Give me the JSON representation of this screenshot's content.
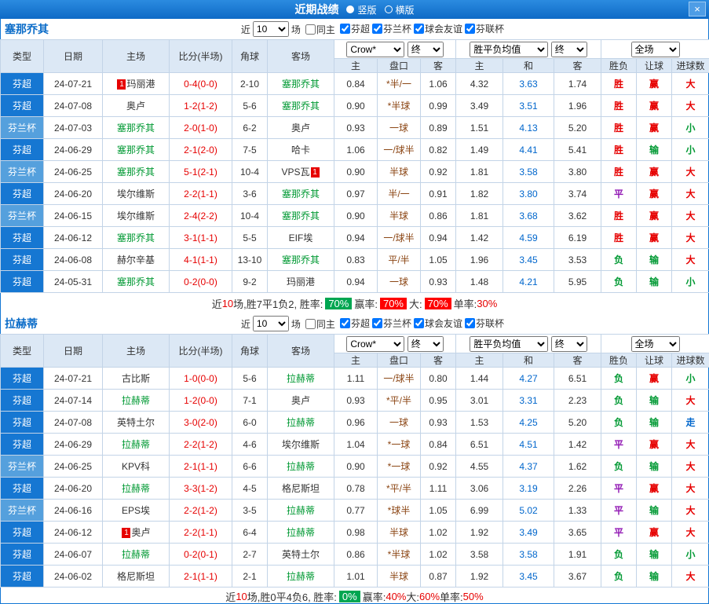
{
  "titlebar": {
    "title": "近期战绩",
    "close_label": "×",
    "layout_options": [
      {
        "label": "竖版",
        "selected": true
      },
      {
        "label": "横版",
        "selected": false
      }
    ]
  },
  "filter": {
    "recent_label": "近",
    "recent_value": "10",
    "games_label": "场",
    "same_home_label": "同主",
    "same_home_checked": false,
    "leagues": [
      "芬超",
      "芬兰杯",
      "球会友谊",
      "芬联杯"
    ],
    "leagues_checked": true
  },
  "table_header": {
    "type": "类型",
    "date": "日期",
    "home": "主场",
    "score": "比分(半场)",
    "corner": "角球",
    "away": "客场",
    "odds_source": "Crow*",
    "odds_time": "终",
    "avg_label": "胜平负均值",
    "avg_time": "终",
    "scope": "全场",
    "home_odds": "主",
    "handicap": "盘口",
    "away_odds": "客",
    "avg_home": "主",
    "avg_draw": "和",
    "avg_away": "客",
    "result": "胜负",
    "handicap_result": "让球",
    "goals": "进球数"
  },
  "league_classes": {
    "芬超": "lg-a",
    "芬兰杯": "lg-b"
  },
  "result_classes": {
    "胜": "r-red",
    "赢": "r-red",
    "大": "r-red",
    "负": "r-green",
    "输": "r-green",
    "小": "r-green",
    "平": "r-purple",
    "走": "r-blue"
  },
  "colors": {
    "title_bar": "#1377d4",
    "league_super": "#1677d2",
    "league_cup": "#55a0dd",
    "team_highlight": "#009933",
    "score": "#e60000",
    "win": "#e60000",
    "lose": "#009933",
    "draw": "#9016b3",
    "push": "#0066cc",
    "badge_green": "#00a651",
    "badge_red": "#fe0000"
  },
  "sections": [
    {
      "team": "塞那乔其",
      "rows": [
        {
          "l": "芬超",
          "d": "24-07-21",
          "h": "玛丽港",
          "hb": "1",
          "ht": false,
          "s": "0-4(0-0)",
          "c": "2-10",
          "a": "塞那乔其",
          "at": true,
          "o1": "0.84",
          "hc": "*半/一",
          "o2": "1.06",
          "v1": "4.32",
          "v2": "3.63",
          "v3": "1.74",
          "r1": "胜",
          "r2": "赢",
          "r3": "大"
        },
        {
          "l": "芬超",
          "d": "24-07-08",
          "h": "奥卢",
          "ht": false,
          "s": "1-2(1-2)",
          "c": "5-6",
          "a": "塞那乔其",
          "at": true,
          "o1": "0.90",
          "hc": "*半球",
          "o2": "0.99",
          "v1": "3.49",
          "v2": "3.51",
          "v3": "1.96",
          "r1": "胜",
          "r2": "赢",
          "r3": "大"
        },
        {
          "l": "芬兰杯",
          "d": "24-07-03",
          "h": "塞那乔其",
          "ht": true,
          "s": "2-0(1-0)",
          "c": "6-2",
          "a": "奥卢",
          "at": false,
          "o1": "0.93",
          "hc": "一球",
          "o2": "0.89",
          "v1": "1.51",
          "v2": "4.13",
          "v3": "5.20",
          "r1": "胜",
          "r2": "赢",
          "r3": "小"
        },
        {
          "l": "芬超",
          "d": "24-06-29",
          "h": "塞那乔其",
          "ht": true,
          "s": "2-1(2-0)",
          "c": "7-5",
          "a": "哈卡",
          "at": false,
          "o1": "1.06",
          "hc": "一/球半",
          "o2": "0.82",
          "v1": "1.49",
          "v2": "4.41",
          "v3": "5.41",
          "r1": "胜",
          "r2": "输",
          "r3": "小"
        },
        {
          "l": "芬兰杯",
          "d": "24-06-25",
          "h": "塞那乔其",
          "ht": true,
          "s": "5-1(2-1)",
          "c": "10-4",
          "a": "VPS瓦",
          "ab": "1",
          "abp": "after",
          "at": false,
          "o1": "0.90",
          "hc": "半球",
          "o2": "0.92",
          "v1": "1.81",
          "v2": "3.58",
          "v3": "3.80",
          "r1": "胜",
          "r2": "赢",
          "r3": "大"
        },
        {
          "l": "芬超",
          "d": "24-06-20",
          "h": "埃尔维斯",
          "ht": false,
          "s": "2-2(1-1)",
          "c": "3-6",
          "a": "塞那乔其",
          "at": true,
          "o1": "0.97",
          "hc": "半/一",
          "o2": "0.91",
          "v1": "1.82",
          "v2": "3.80",
          "v3": "3.74",
          "r1": "平",
          "r2": "赢",
          "r3": "大"
        },
        {
          "l": "芬兰杯",
          "d": "24-06-15",
          "h": "埃尔维斯",
          "ht": false,
          "s": "2-4(2-2)",
          "c": "10-4",
          "a": "塞那乔其",
          "at": true,
          "o1": "0.90",
          "hc": "半球",
          "o2": "0.86",
          "v1": "1.81",
          "v2": "3.68",
          "v3": "3.62",
          "r1": "胜",
          "r2": "赢",
          "r3": "大"
        },
        {
          "l": "芬超",
          "d": "24-06-12",
          "h": "塞那乔其",
          "ht": true,
          "s": "3-1(1-1)",
          "c": "5-5",
          "a": "EIF埃",
          "at": false,
          "o1": "0.94",
          "hc": "一/球半",
          "o2": "0.94",
          "v1": "1.42",
          "v2": "4.59",
          "v3": "6.19",
          "r1": "胜",
          "r2": "赢",
          "r3": "大"
        },
        {
          "l": "芬超",
          "d": "24-06-08",
          "h": "赫尔辛基",
          "ht": false,
          "s": "4-1(1-1)",
          "c": "13-10",
          "a": "塞那乔其",
          "at": true,
          "o1": "0.83",
          "hc": "平/半",
          "o2": "1.05",
          "v1": "1.96",
          "v2": "3.45",
          "v3": "3.53",
          "r1": "负",
          "r2": "输",
          "r3": "大"
        },
        {
          "l": "芬超",
          "d": "24-05-31",
          "h": "塞那乔其",
          "ht": true,
          "s": "0-2(0-0)",
          "c": "9-2",
          "a": "玛丽港",
          "at": false,
          "o1": "0.94",
          "hc": "一球",
          "o2": "0.93",
          "v1": "1.48",
          "v2": "4.21",
          "v3": "5.95",
          "r1": "负",
          "r2": "输",
          "r3": "小"
        }
      ],
      "summary": [
        {
          "t": "近",
          "c": "plain"
        },
        {
          "t": "10",
          "c": "red"
        },
        {
          "t": "场,胜7平1负2, 胜率: ",
          "c": "plain"
        },
        {
          "t": "70%",
          "c": "badge-green"
        },
        {
          "t": " 赢率: ",
          "c": "plain"
        },
        {
          "t": "70%",
          "c": "badge-red"
        },
        {
          "t": " 大: ",
          "c": "plain"
        },
        {
          "t": "70%",
          "c": "badge-red"
        },
        {
          "t": " 单率:",
          "c": "plain"
        },
        {
          "t": "30%",
          "c": "red"
        }
      ]
    },
    {
      "team": "拉赫蒂",
      "rows": [
        {
          "l": "芬超",
          "d": "24-07-21",
          "h": "古比斯",
          "ht": false,
          "s": "1-0(0-0)",
          "c": "5-6",
          "a": "拉赫蒂",
          "at": true,
          "o1": "1.11",
          "hc": "一/球半",
          "o2": "0.80",
          "v1": "1.44",
          "v2": "4.27",
          "v3": "6.51",
          "r1": "负",
          "r2": "赢",
          "r3": "小"
        },
        {
          "l": "芬超",
          "d": "24-07-14",
          "h": "拉赫蒂",
          "ht": true,
          "s": "1-2(0-0)",
          "c": "7-1",
          "a": "奥卢",
          "at": false,
          "o1": "0.93",
          "hc": "*平/半",
          "o2": "0.95",
          "v1": "3.01",
          "v2": "3.31",
          "v3": "2.23",
          "r1": "负",
          "r2": "输",
          "r3": "大"
        },
        {
          "l": "芬超",
          "d": "24-07-08",
          "h": "英特土尔",
          "ht": false,
          "s": "3-0(2-0)",
          "c": "6-0",
          "a": "拉赫蒂",
          "at": true,
          "o1": "0.96",
          "hc": "一球",
          "o2": "0.93",
          "v1": "1.53",
          "v2": "4.25",
          "v3": "5.20",
          "r1": "负",
          "r2": "输",
          "r3": "走"
        },
        {
          "l": "芬超",
          "d": "24-06-29",
          "h": "拉赫蒂",
          "ht": true,
          "s": "2-2(1-2)",
          "c": "4-6",
          "a": "埃尔维斯",
          "at": false,
          "o1": "1.04",
          "hc": "*一球",
          "o2": "0.84",
          "v1": "6.51",
          "v2": "4.51",
          "v3": "1.42",
          "r1": "平",
          "r2": "赢",
          "r3": "大"
        },
        {
          "l": "芬兰杯",
          "d": "24-06-25",
          "h": "KPV科",
          "ht": false,
          "s": "2-1(1-1)",
          "c": "6-6",
          "a": "拉赫蒂",
          "at": true,
          "o1": "0.90",
          "hc": "*一球",
          "o2": "0.92",
          "v1": "4.55",
          "v2": "4.37",
          "v3": "1.62",
          "r1": "负",
          "r2": "输",
          "r3": "大"
        },
        {
          "l": "芬超",
          "d": "24-06-20",
          "h": "拉赫蒂",
          "ht": true,
          "s": "3-3(1-2)",
          "c": "4-5",
          "a": "格尼斯坦",
          "at": false,
          "o1": "0.78",
          "hc": "*平/半",
          "o2": "1.11",
          "v1": "3.06",
          "v2": "3.19",
          "v3": "2.26",
          "r1": "平",
          "r2": "赢",
          "r3": "大"
        },
        {
          "l": "芬兰杯",
          "d": "24-06-16",
          "h": "EPS埃",
          "ht": false,
          "s": "2-2(1-2)",
          "c": "3-5",
          "a": "拉赫蒂",
          "at": true,
          "o1": "0.77",
          "hc": "*球半",
          "o2": "1.05",
          "v1": "6.99",
          "v2": "5.02",
          "v3": "1.33",
          "r1": "平",
          "r2": "输",
          "r3": "大"
        },
        {
          "l": "芬超",
          "d": "24-06-12",
          "h": "奥卢",
          "hb": "1",
          "ht": false,
          "s": "2-2(1-1)",
          "c": "6-4",
          "a": "拉赫蒂",
          "at": true,
          "o1": "0.98",
          "hc": "半球",
          "o2": "1.02",
          "v1": "1.92",
          "v2": "3.49",
          "v3": "3.65",
          "r1": "平",
          "r2": "赢",
          "r3": "大"
        },
        {
          "l": "芬超",
          "d": "24-06-07",
          "h": "拉赫蒂",
          "ht": true,
          "s": "0-2(0-1)",
          "c": "2-7",
          "a": "英特土尔",
          "at": false,
          "o1": "0.86",
          "hc": "*半球",
          "o2": "1.02",
          "v1": "3.58",
          "v2": "3.58",
          "v3": "1.91",
          "r1": "负",
          "r2": "输",
          "r3": "小"
        },
        {
          "l": "芬超",
          "d": "24-06-02",
          "h": "格尼斯坦",
          "ht": false,
          "s": "2-1(1-1)",
          "c": "2-1",
          "a": "拉赫蒂",
          "at": true,
          "o1": "1.01",
          "hc": "半球",
          "o2": "0.87",
          "v1": "1.92",
          "v2": "3.45",
          "v3": "3.67",
          "r1": "负",
          "r2": "输",
          "r3": "大"
        }
      ],
      "summary": [
        {
          "t": "近",
          "c": "plain"
        },
        {
          "t": "10",
          "c": "red"
        },
        {
          "t": "场,胜0平4负6, 胜率: ",
          "c": "plain"
        },
        {
          "t": "0%",
          "c": "badge-green"
        },
        {
          "t": " 赢率:",
          "c": "plain"
        },
        {
          "t": "40%",
          "c": "red"
        },
        {
          "t": " 大:",
          "c": "plain"
        },
        {
          "t": "60%",
          "c": "red"
        },
        {
          "t": " 单率:",
          "c": "plain"
        },
        {
          "t": "50%",
          "c": "red"
        }
      ]
    }
  ]
}
